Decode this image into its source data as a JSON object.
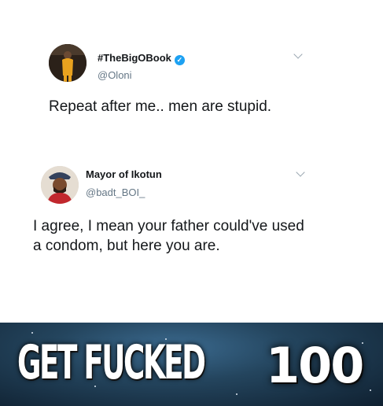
{
  "tweet1": {
    "display_name": "#TheBigOBook",
    "handle": "@Oloni",
    "text": "Repeat after me.. men are stupid.",
    "verified": true
  },
  "tweet2": {
    "display_name": "Mayor of Ikotun",
    "handle": "@badt_BOI_",
    "text": "I agree, I mean your father could've used a condom, but here you are."
  },
  "meme": {
    "caption": "GET FUCKED",
    "number": "100"
  },
  "icons": [
    "verified-badge-icon",
    "chevron-down-icon"
  ],
  "colors": {
    "verified": "#1da1f2",
    "handle": "#657786",
    "text": "#14171a"
  }
}
